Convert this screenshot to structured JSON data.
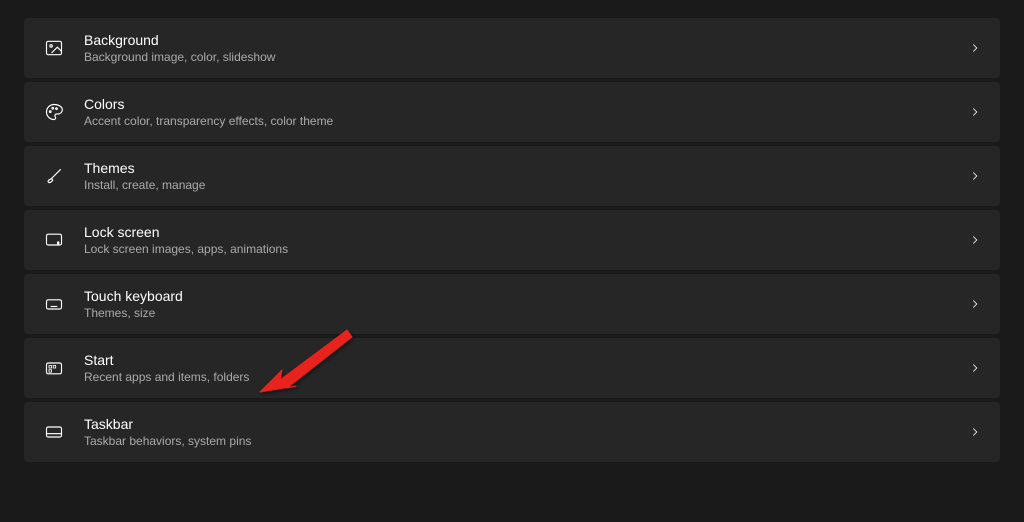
{
  "items": [
    {
      "icon": "image-icon",
      "title": "Background",
      "subtitle": "Background image, color, slideshow"
    },
    {
      "icon": "palette-icon",
      "title": "Colors",
      "subtitle": "Accent color, transparency effects, color theme"
    },
    {
      "icon": "brush-icon",
      "title": "Themes",
      "subtitle": "Install, create, manage"
    },
    {
      "icon": "lock-screen-icon",
      "title": "Lock screen",
      "subtitle": "Lock screen images, apps, animations"
    },
    {
      "icon": "keyboard-icon",
      "title": "Touch keyboard",
      "subtitle": "Themes, size"
    },
    {
      "icon": "start-icon",
      "title": "Start",
      "subtitle": "Recent apps and items, folders"
    },
    {
      "icon": "taskbar-icon",
      "title": "Taskbar",
      "subtitle": "Taskbar behaviors, system pins"
    }
  ]
}
